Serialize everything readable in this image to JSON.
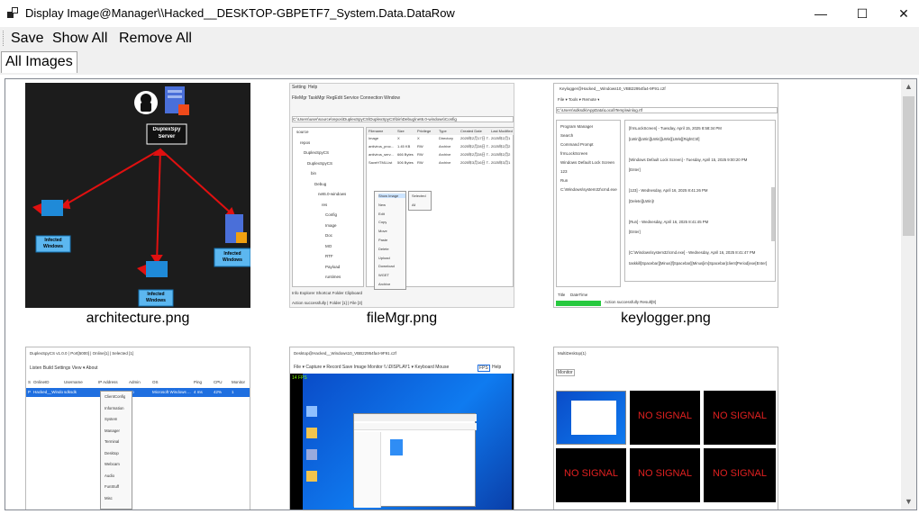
{
  "window": {
    "title": "Display Image@Manager\\\\Hacked__DESKTOP-GBPETF7_System.Data.DataRow",
    "minimize_symbol": "—",
    "maximize_symbol": "☐",
    "close_symbol": "✕",
    "app_icon": "window-icon"
  },
  "menu": {
    "save": "Save",
    "show_all": "Show All",
    "remove_all": "Remove All"
  },
  "tabs": [
    {
      "label": "All Images"
    }
  ],
  "scrollbar": {
    "up": "▲",
    "down": "▼"
  },
  "images": [
    {
      "caption": "architecture.png",
      "server_label_1": "DuplexSpy",
      "server_label_2": "Server",
      "victim_label_1": "Infected",
      "victim_label_2": "Windows"
    },
    {
      "caption": "fileMgr.png",
      "menu_setting": "Setting",
      "menu_help": "Help",
      "tabs_text": "FileMgr   TaskMgr   RegEdit   Service   Connection   Window",
      "path_text": "C:\\Users\\user\\source\\repos\\DuplexSpyCS\\DuplexSpyCS\\bin\\Debug\\net6.0-windows\\Config",
      "tree_items": [
        "source",
        "repos",
        "DuplexSpyCS",
        "DuplexSpyCS",
        "bin",
        "Debug",
        "net6.0-windows",
        "res",
        "Config",
        "Image",
        "Doc",
        "MO",
        "RTF",
        "Payload",
        "runtimes"
      ],
      "col_headers": [
        "Filename",
        "Size",
        "Privilege",
        "Type",
        "Created Date",
        "Last Modified"
      ],
      "file_rows": [
        [
          "Image",
          "X",
          "X",
          "Directory",
          "2025年2月17日 T...",
          "2025年2月1"
        ],
        [
          "antivirus_proc...",
          "1.45 KB",
          "RW",
          "Archive",
          "2025年2月28日 T...",
          "2025年2月2"
        ],
        [
          "antivirus_serv...",
          "666 Bytes",
          "RW",
          "Archive",
          "2025年2月28日 T...",
          "2025年2月2"
        ],
        [
          "SaveHTMLList",
          "506 Bytes",
          "RW",
          "Archive",
          "2025年3月16日 T...",
          "2025年3月1"
        ]
      ],
      "context_items": [
        "Show Image",
        "New",
        "Edit",
        "Copy",
        "Move",
        "Paste",
        "Delete",
        "Upload",
        "Download",
        "WGET",
        "Archive"
      ],
      "submenu_items": [
        "Selected",
        "All"
      ],
      "bottom_tabs": "Info   Explorer   Shortcut   Folder   Clipboard",
      "status": "Action successfully | Folder [1] | File [3]"
    },
    {
      "caption": "keylogger.png",
      "title": "Keylogger@Hacked__Windows10_VBB22954fa4-9F91.c2f",
      "menubar": "File ▾   Tools ▾   Remote ▾",
      "path": "C:\\Users\\sdksdk\\AppData\\Local\\Temp\\winlog.rtf",
      "list_items": [
        "Program Manager",
        "Search",
        "Command Prompt",
        "frmLockScreen",
        "Windows Default Lock Screen",
        "123",
        "Run",
        "C:\\Windows\\system32\\cmd.exe"
      ],
      "log_lines": [
        "[frmLockScreen] - Tuesday, April 15, 2025 8:58:34 PM",
        "[LWin][LWin][LWin][LWin][LWin][RightCtrl]",
        "",
        "[Windows Default Lock Screen] - Tuesday, April 15, 2025 9:00:20 PM",
        "[Enter]",
        "",
        "[123] - Wednesday, April 16, 2025 8:41:26 PM",
        "[Delete][LWin]r",
        "",
        "[Run] - Wednesday, April 16, 2025 8:41:45 PM",
        "[Enter]",
        "",
        "[C:\\Windows\\system32\\cmd.exe] - Wednesday, April 16, 2025 8:41:47 PM",
        "taskkill[Spacebar][Minus]f[Spacebar][Minus]im[Spacebar]client[Period]exe[Enter]"
      ],
      "col_title": "Title",
      "col_datetime": "DateTime",
      "status": "Action successfully Result[9]"
    },
    {
      "caption": "",
      "title": "DuplexSpyCS v1.0.0 | Port[5000] | Online[1] | Selected [1]",
      "menubar": "Listen   Build   Settings   View ▾   About",
      "headers": [
        "S",
        "OnlineID",
        "Username",
        "IP Address",
        "Admin",
        "OS",
        "Ping",
        "CPU",
        "Monitor"
      ],
      "row": [
        "P",
        "Hacked__Windo...",
        "sdksdk",
        "",
        "No",
        "Microsoft Windows ...",
        "4 ms",
        "42%",
        "1"
      ],
      "context_items": [
        "ClientConfig",
        "Information",
        "System",
        "Manager",
        "Terminal",
        "Desktop",
        "Webcam",
        "Audio",
        "FunStuff",
        "Misc"
      ]
    },
    {
      "caption": "",
      "title": "Desktop@Hacked__Windows10_VBB22954fa4-9F91.c2f",
      "menubar": "File ▾  Capture ▾   Record  Save Image   Monitor  \\\\.\\DISPLAY1 ▾   Keyboard  Mouse",
      "fps_label": "FPS",
      "help_label": "Help",
      "fps_counter": "14 FPS"
    },
    {
      "caption": "",
      "title": "MultiDesktop(1)",
      "monitor_label": "Monitor",
      "no_signal": "NO SIGNAL"
    }
  ]
}
